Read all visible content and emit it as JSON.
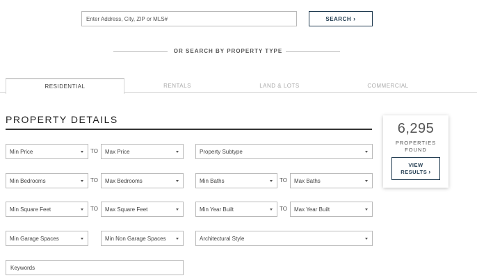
{
  "search": {
    "placeholder": "Enter Address, City, ZIP or MLS#",
    "button_label": "SEARCH"
  },
  "divider": {
    "text": "OR SEARCH BY PROPERTY TYPE"
  },
  "tabs": [
    {
      "label": "RESIDENTIAL",
      "active": true
    },
    {
      "label": "RENTALS",
      "active": false
    },
    {
      "label": "LAND & LOTS",
      "active": false
    },
    {
      "label": "COMMERCIAL",
      "active": false
    }
  ],
  "section": {
    "title": "PROPERTY DETAILS"
  },
  "filters": {
    "min_price": "Min Price",
    "max_price": "Max Price",
    "property_subtype": "Property Subtype",
    "min_bedrooms": "Min Bedrooms",
    "max_bedrooms": "Max Bedrooms",
    "min_baths": "Min Baths",
    "max_baths": "Max Baths",
    "min_square_feet": "Min Square Feet",
    "max_square_feet": "Max Square Feet",
    "min_year_built": "Min Year Built",
    "max_year_built": "Max Year Built",
    "min_garage_spaces": "Min Garage Spaces",
    "min_non_garage_spaces": "Min Non Garage Spaces",
    "architectural_style": "Architectural Style",
    "to_label": "TO",
    "keywords_placeholder": "Keywords"
  },
  "results": {
    "count": "6,295",
    "label_line1": "PROPERTIES",
    "label_line2": "FOUND",
    "button_line1": "VIEW",
    "button_line2": "RESULTS"
  },
  "icons": {
    "chevron": "chevron-right-icon",
    "caret": "caret-down-icon"
  },
  "colors": {
    "accent": "#1f3a4f",
    "border": "#b9b9b9",
    "text": "#333333"
  }
}
